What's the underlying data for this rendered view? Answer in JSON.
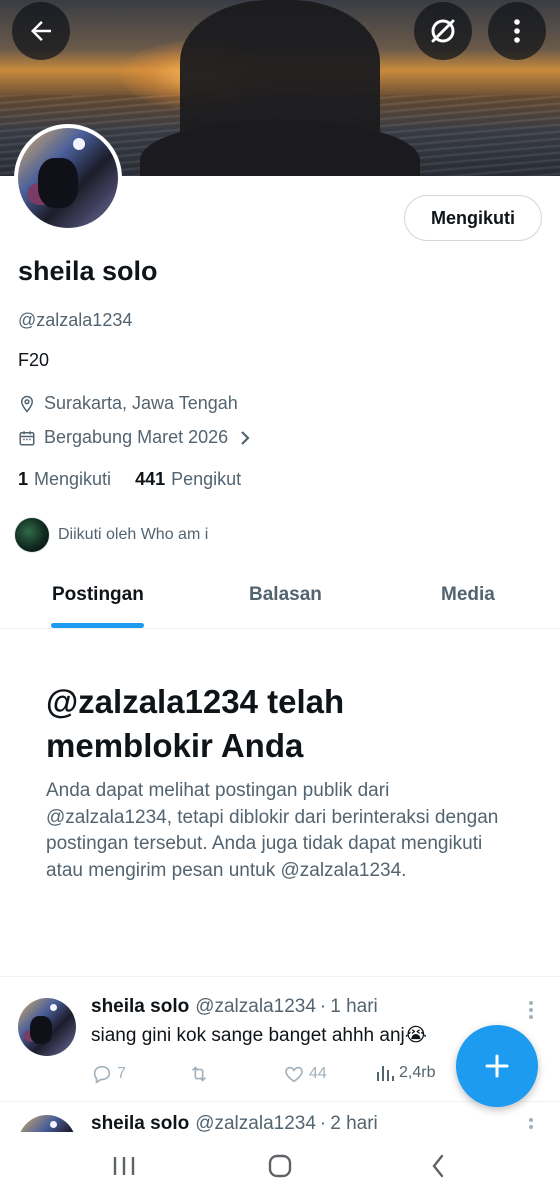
{
  "header": {
    "back_icon": "arrow-left-icon",
    "notifications_icon": "bell-off-icon",
    "more_icon": "vertical-dots-icon"
  },
  "profile": {
    "name": "sheila solo",
    "handle": "@zalzala1234",
    "bio": "F20",
    "location": "Surakarta, Jawa Tengah",
    "joined": "Bergabung Maret 2026",
    "follow_button_label": "Mengikuti",
    "following_count": "1",
    "following_label": "Mengikuti",
    "followers_count": "441",
    "followers_label": "Pengikut",
    "followed_by": "Diikuti oleh Who am i"
  },
  "tabs": [
    {
      "label": "Postingan",
      "active": true
    },
    {
      "label": "Balasan",
      "active": false
    },
    {
      "label": "Media",
      "active": false
    }
  ],
  "blocked_notice": {
    "title": "@zalzala1234 telah memblokir Anda",
    "body": "Anda dapat melihat postingan publik dari @zalzala1234, tetapi diblokir dari berinteraksi dengan postingan tersebut. Anda juga tidak dapat mengikuti atau mengirim pesan untuk @zalzala1234."
  },
  "tweets": [
    {
      "name": "sheila solo",
      "handle": "@zalzala1234",
      "time": "1 hari",
      "text": "siang gini kok sange banget ahhh anj😭",
      "replies": "7",
      "retweets": "",
      "likes": "44",
      "views": "2,4rb"
    },
    {
      "name": "sheila solo",
      "handle": "@zalzala1234",
      "time": "2 hari"
    }
  ],
  "fab_icon": "plus-icon",
  "colors": {
    "accent": "#1d9bf0",
    "text_primary": "#0f1419",
    "text_secondary": "#536471"
  }
}
